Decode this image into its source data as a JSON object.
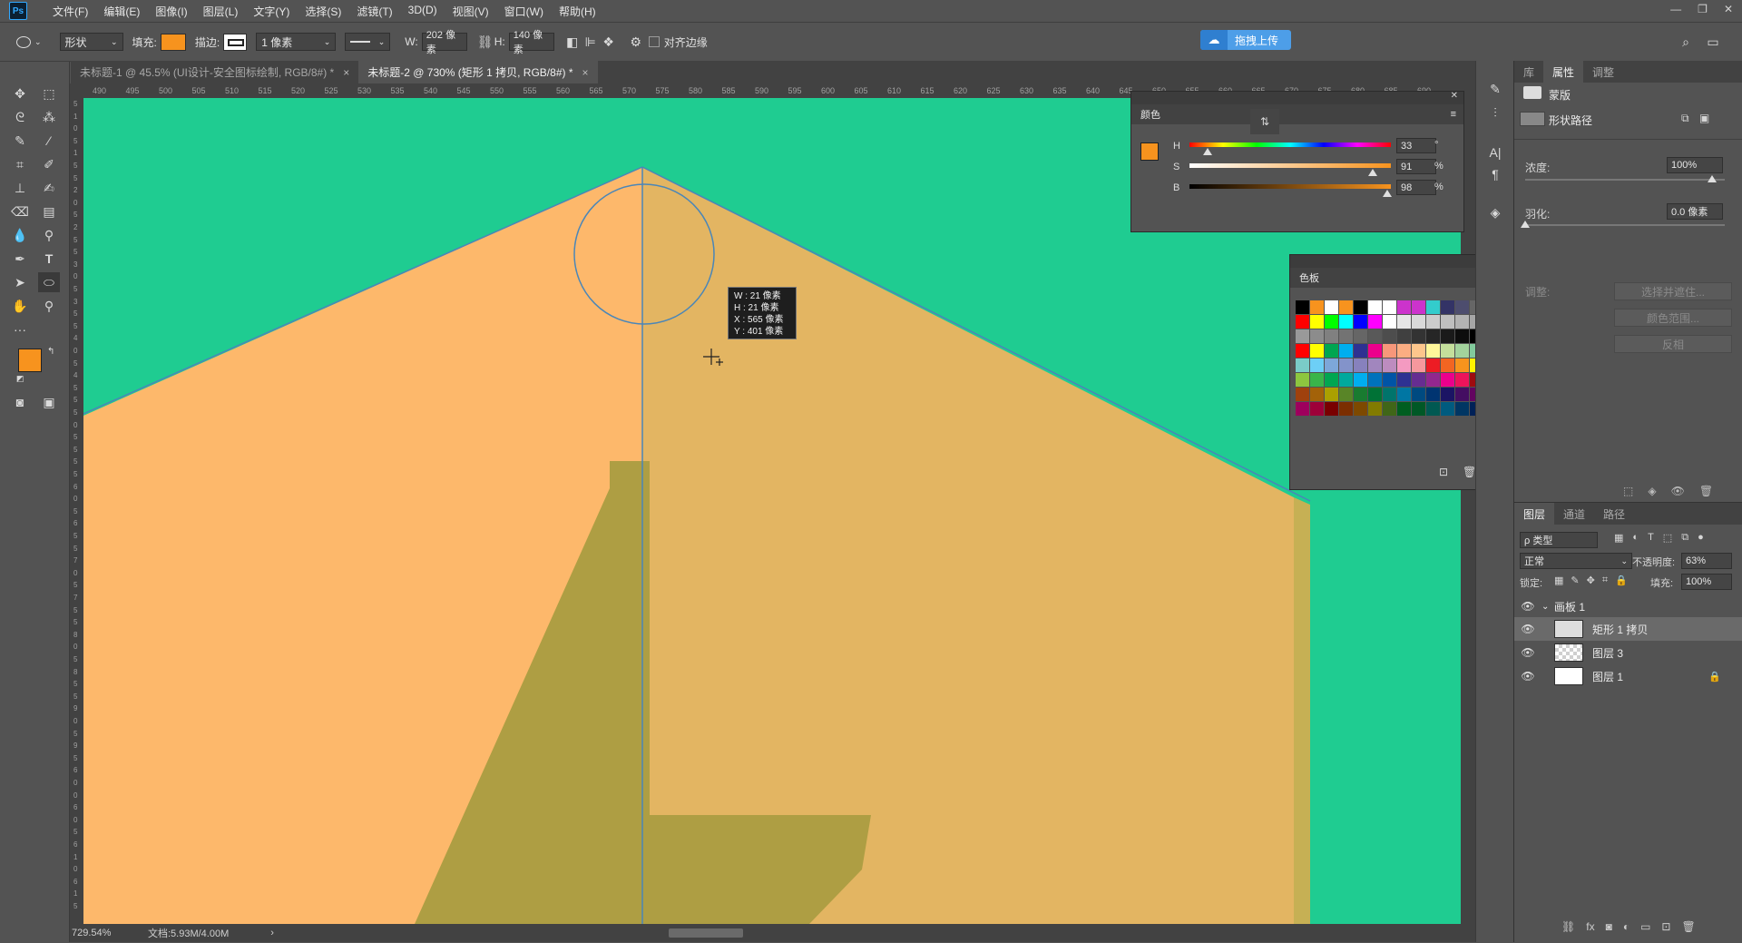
{
  "menubar": {
    "logo": "Ps",
    "items": [
      "文件(F)",
      "编辑(E)",
      "图像(I)",
      "图层(L)",
      "文字(Y)",
      "选择(S)",
      "滤镜(T)",
      "3D(D)",
      "视图(V)",
      "窗口(W)",
      "帮助(H)"
    ]
  },
  "options": {
    "mode": "形状",
    "fill_label": "填充:",
    "stroke_label": "描边:",
    "stroke_width": "1 像素",
    "w_label": "W:",
    "w_value": "202 像素",
    "h_label": "H:",
    "h_value": "140 像素",
    "align_edges": "对齐边缘",
    "upload_label": "拖拽上传",
    "fill_color": "#f7931e"
  },
  "tabs": [
    {
      "label": "未标题-1 @ 45.5% (UI设计-安全图标绘制, RGB/8#) *",
      "close": "×"
    },
    {
      "label": "未标题-2 @ 730% (矩形 1 拷贝, RGB/8#) *",
      "close": "×"
    }
  ],
  "ruler_ticks": [
    "490",
    "495",
    "500",
    "505",
    "510",
    "515",
    "520",
    "525",
    "530",
    "535",
    "540",
    "545",
    "550",
    "555",
    "560",
    "565",
    "570",
    "575",
    "580",
    "585",
    "590",
    "595",
    "600",
    "605",
    "610",
    "615",
    "620",
    "625",
    "630",
    "635",
    "640",
    "645",
    "650",
    "655",
    "660",
    "665",
    "670",
    "675",
    "680",
    "685",
    "690"
  ],
  "vruler_ticks": [
    "5",
    "1",
    "0",
    "5",
    "1",
    "5",
    "5",
    "2",
    "0",
    "5",
    "2",
    "5",
    "5",
    "3",
    "0",
    "5",
    "3",
    "5",
    "5",
    "4",
    "0",
    "5",
    "4",
    "5",
    "5",
    "5",
    "0",
    "5",
    "5",
    "5",
    "5",
    "6",
    "0",
    "5",
    "6",
    "5",
    "5",
    "7",
    "0",
    "5",
    "7",
    "5",
    "5",
    "8",
    "0",
    "5",
    "8",
    "5",
    "5",
    "9",
    "0",
    "5",
    "9",
    "5",
    "6",
    "0",
    "0",
    "6",
    "0",
    "5",
    "6",
    "1",
    "0",
    "6",
    "1",
    "5"
  ],
  "tooltip": {
    "w": "W :   21 像素",
    "h": "H :   21 像素",
    "x": "X :  565 像素",
    "y": "Y :  401 像素"
  },
  "statusbar": {
    "zoom": "729.54%",
    "doc": "文档:5.93M/4.00M"
  },
  "color_panel": {
    "title": "颜色",
    "rows": [
      {
        "label": "H",
        "value": "33",
        "unit": "°",
        "pos": 0.09
      },
      {
        "label": "S",
        "value": "91",
        "unit": "%",
        "pos": 0.91
      },
      {
        "label": "B",
        "value": "98",
        "unit": "%",
        "pos": 0.98
      }
    ]
  },
  "swatches_panel": {
    "title": "色板",
    "colors": [
      "#000000",
      "#f7931e",
      "#ffffff",
      "#f7931e",
      "#000000",
      "#ffffff",
      "#ffffff",
      "#cc33cc",
      "#cc33cc",
      "#33cccc",
      "#333366",
      "#4d4d6e",
      "#666666",
      "#ff0000",
      "#ffff00",
      "#00ff00",
      "#00ffff",
      "#0000ff",
      "#ff00ff",
      "#ffffff",
      "#e6e6e6",
      "#d9d9d9",
      "#cccccc",
      "#bfbfbf",
      "#b3b3b3",
      "#a6a6a6",
      "#999999",
      "#8c8c8c",
      "#808080",
      "#737373",
      "#666666",
      "#595959",
      "#4d4d4d",
      "#404040",
      "#333333",
      "#262626",
      "#1a1a1a",
      "#0d0d0d",
      "#000000",
      "#ff0000",
      "#ffff00",
      "#00a651",
      "#00aeef",
      "#2e3192",
      "#ec008c",
      "#f7977a",
      "#fbad82",
      "#fdc68c",
      "#fff79a",
      "#c4df9b",
      "#a3d39c",
      "#82ca9c",
      "#7accc8",
      "#6dcff6",
      "#7da7d9",
      "#8393ca",
      "#8781bd",
      "#a186be",
      "#bd8cbf",
      "#f49ac1",
      "#f6989d",
      "#ed1c24",
      "#f26522",
      "#f7941d",
      "#fff200",
      "#8dc63f",
      "#39b54a",
      "#00a651",
      "#00a99d",
      "#00aeef",
      "#0072bc",
      "#0054a6",
      "#2e3192",
      "#662d91",
      "#92278f",
      "#ec008c",
      "#ed145b",
      "#9e0b0f",
      "#a0410d",
      "#a36209",
      "#aba000",
      "#598527",
      "#197b30",
      "#007236",
      "#00746b",
      "#0076a3",
      "#004a80",
      "#003471",
      "#1b1464",
      "#440e62",
      "#630460",
      "#9e005d",
      "#9e0039",
      "#790000",
      "#7b2e00",
      "#7d4900",
      "#827b00",
      "#406618",
      "#005e20",
      "#005826",
      "#005952",
      "#005b7f",
      "#003663",
      "#002157"
    ]
  },
  "properties_panel": {
    "tabs": [
      "库",
      "属性",
      "调整"
    ],
    "mask_label": "蒙版",
    "vector_mask_label": "形状路径",
    "density_label": "浓度:",
    "density_value": "100%",
    "feather_label": "羽化:",
    "feather_value": "0.0 像素",
    "adjust_label": "调整:",
    "btn_select_mask": "选择并遮住...",
    "btn_color_range": "颜色范围...",
    "btn_invert": "反相"
  },
  "layers_panel": {
    "tabs": [
      "图层",
      "通道",
      "路径"
    ],
    "filter_label": "ρ 类型",
    "blend_mode": "正常",
    "opacity_label": "不透明度:",
    "opacity_value": "63%",
    "lock_label": "锁定:",
    "fill_label": "填充:",
    "fill_value": "100%",
    "layers": [
      {
        "name": "画板 1",
        "kind": "artboard"
      },
      {
        "name": "矩形 1 拷贝",
        "kind": "shape",
        "selected": true
      },
      {
        "name": "图层 3",
        "kind": "pixel"
      },
      {
        "name": "图层 1",
        "kind": "white",
        "locked": true
      }
    ]
  }
}
